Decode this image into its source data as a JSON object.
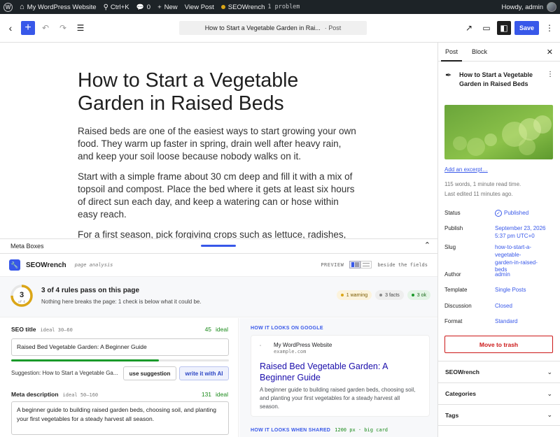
{
  "admin_bar": {
    "site_name": "My WordPress Website",
    "shortcut": "Ctrl+K",
    "comments_count": "0",
    "new_label": "New",
    "view_post": "View Post",
    "plugin_name": "SEOWrench",
    "plugin_problems": "1 problem",
    "howdy": "Howdy, admin"
  },
  "editor_header": {
    "document_title": "How to Start a Vegetable Garden in Rai...",
    "document_kind": "· Post",
    "save_label": "Save"
  },
  "post": {
    "title": "How to Start a Vegetable Garden in Raised Beds",
    "paragraphs": [
      "Raised beds are one of the easiest ways to start growing your own food. They warm up faster in spring, drain well after heavy rain, and keep your soil loose because nobody walks on it.",
      "Start with a simple frame about 30 cm deep and fill it with a mix of topsoil and compost. Place the bed where it gets at least six hours of direct sun each day, and keep a watering can or hose within easy reach.",
      "For a first season, pick forgiving crops such as lettuce, radishes, bush beans and zucchini."
    ]
  },
  "meta_boxes": {
    "label": "Meta Boxes"
  },
  "seowrench": {
    "name": "SEOWrench",
    "subtitle": "page analysis",
    "preview_label": "PREVIEW",
    "beside_label": "beside the fields",
    "score": "3",
    "score_of": "of 4",
    "summary_title": "3 of 4 rules pass on this page",
    "summary_sub": "Nothing here breaks the page: 1 check is below what it could be.",
    "chips": [
      {
        "label": "1 warning",
        "color": "#dba617"
      },
      {
        "label": "3 facts",
        "color": "#888888"
      },
      {
        "label": "3 ok",
        "color": "#1a9a2a"
      }
    ],
    "seo_title": {
      "label": "SEO title",
      "hint": "ideal 30–60",
      "count": "45",
      "status": "ideal",
      "value": "Raised Bed Vegetable Garden: A Beginner Guide",
      "progress": 0.68
    },
    "suggestion_text": "Suggestion: How to Start a Vegetable Ga...",
    "use_suggestion": "use suggestion",
    "write_ai": "write it with AI",
    "meta_description": {
      "label": "Meta description",
      "hint": "ideal 50–160",
      "count": "131",
      "status": "ideal",
      "value": "A beginner guide to building raised garden beds, choosing soil, and planting your first vegetables for a steady harvest all season."
    },
    "google_label": "HOW IT LOOKS ON GOOGLE",
    "google": {
      "site": "My WordPress Website",
      "url": "example.com",
      "title": "Raised Bed Vegetable Garden: A Beginner Guide",
      "description": "A beginner guide to building raised garden beds, choosing soil, and planting your first vegetables for a steady harvest all season."
    },
    "shared_label": "HOW IT LOOKS WHEN SHARED",
    "shared_meta": "1200 px · big card"
  },
  "sidebar": {
    "tab_post": "Post",
    "tab_block": "Block",
    "post_title": "How to Start a Vegetable Garden in Raised Beds",
    "add_excerpt": "Add an excerpt…",
    "word_info": "115 words, 1 minute read time.",
    "last_edited": "Last edited 11 minutes ago.",
    "rows": [
      {
        "key": "Status",
        "value": "Published"
      },
      {
        "key": "Publish",
        "value": "September 23, 2026 5:37 pm UTC+0"
      },
      {
        "key": "Slug",
        "value": "how-to-start-a-vegetable-garden-in-raised-beds"
      },
      {
        "key": "Author",
        "value": "admin"
      },
      {
        "key": "Template",
        "value": "Single Posts"
      },
      {
        "key": "Discussion",
        "value": "Closed"
      },
      {
        "key": "Format",
        "value": "Standard"
      }
    ],
    "trash": "Move to trash",
    "panels": [
      "SEOWrench",
      "Categories",
      "Tags"
    ]
  }
}
